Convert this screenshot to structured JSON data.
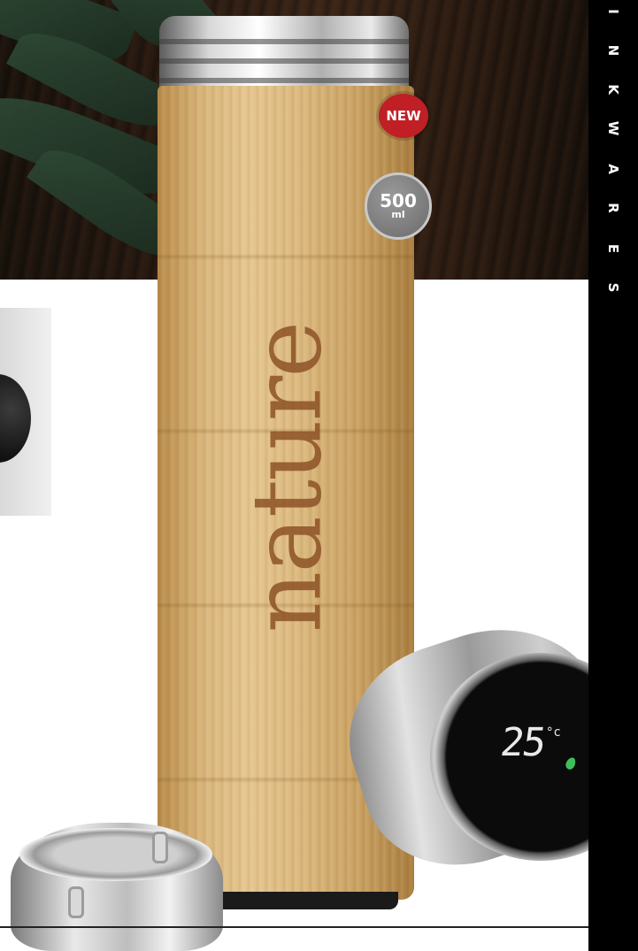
{
  "brand_strip": {
    "letters": [
      "I",
      "N",
      "K",
      "W",
      "A",
      "R",
      "E",
      "S"
    ]
  },
  "badges": {
    "new_label": "NEW",
    "volume_value": "500",
    "volume_unit": "ml"
  },
  "product": {
    "engraving": "nature",
    "display_temperature": "25",
    "display_unit": "°c"
  },
  "colors": {
    "badge_new": "#c01f25",
    "badge_volume": "#7d7d7d",
    "engraving": "#8a4f23",
    "strip": "#000000",
    "drop": "#3fbf5a"
  },
  "icons": {
    "droplet": "leaf-drop-icon"
  }
}
